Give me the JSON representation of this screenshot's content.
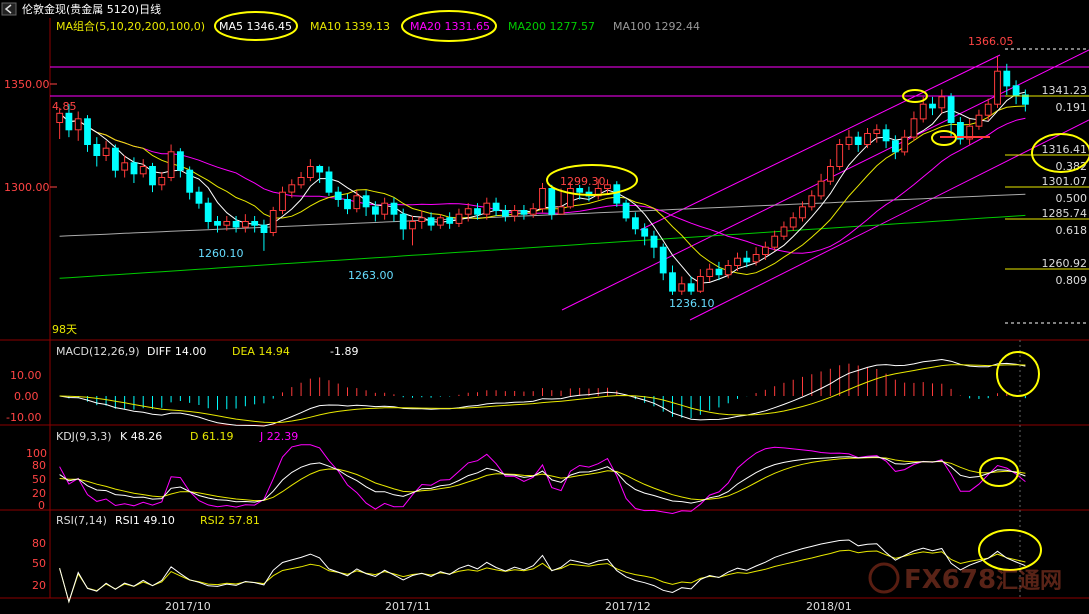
{
  "window": {
    "title": "伦敦金现(贵金属 5120)日线"
  },
  "colors": {
    "bg": "#000000",
    "up": "#ff3b3b",
    "down": "#00ffff",
    "ma5": "#ffffff",
    "ma10": "#e8e800",
    "ma20": "#ff00ff",
    "ma100": "#aaaaaa",
    "ma200": "#00cc00",
    "fib": "#e8e800",
    "grid": "#8b0000",
    "circle": "#ffff00",
    "channel": "#ff00ff"
  },
  "main": {
    "ma_header": {
      "label": "MA组合(5,10,20,200,100,0)",
      "ma5": "MA5 1346.45",
      "ma10": "MA10 1339.13",
      "ma20": "MA20 1331.65",
      "ma200": "MA200 1277.57",
      "ma100": "MA100 1292.44"
    },
    "yticks": [
      "1350.00",
      "1300.00"
    ],
    "left_corner_label": "4.85",
    "days_label": "98天",
    "annotations": {
      "high": "1366.05",
      "peak_mid": "1299.30",
      "low_a": "1260.10",
      "low_b": "1263.00",
      "low_c": "1236.10"
    },
    "fib_levels": [
      {
        "price": "1341.23",
        "ratio": "0.191"
      },
      {
        "price": "1316.41",
        "ratio": "0.382"
      },
      {
        "price": "1301.07",
        "ratio": "0.500"
      },
      {
        "price": "1285.74",
        "ratio": "0.618"
      },
      {
        "price": "1260.92",
        "ratio": "0.809"
      }
    ]
  },
  "macd": {
    "label": "MACD(12,26,9)",
    "diff": "DIFF  14.00",
    "dea": "DEA  14.94",
    "macd": "-1.89",
    "yticks": [
      "10.00",
      "0.00",
      "-10.00"
    ]
  },
  "kdj": {
    "label": "KDJ(9,3,3)",
    "k": "K  48.26",
    "d": "D  61.19",
    "j": "J  22.39",
    "yticks": [
      "100",
      "80",
      "50",
      "20",
      "0"
    ]
  },
  "rsi": {
    "label": "RSI(7,14)",
    "rsi1": "RSI1  49.10",
    "rsi2": "RSI2  57.81",
    "yticks": [
      "80",
      "50",
      "20"
    ]
  },
  "xaxis": {
    "labels": [
      "2017/10",
      "2017/11",
      "2017/12",
      "2018/01"
    ]
  },
  "watermark": {
    "text": "FX678",
    "sub": "汇通网"
  },
  "chart_data": {
    "type": "candlestick",
    "title": "伦敦金现(贵金属 5120)日线",
    "candles": [
      [
        1330,
        1335,
        1338,
        1321
      ],
      [
        1335,
        1326,
        1340,
        1322
      ],
      [
        1326,
        1332,
        1336,
        1320
      ],
      [
        1332,
        1318,
        1334,
        1314
      ],
      [
        1318,
        1312,
        1322,
        1306
      ],
      [
        1312,
        1316,
        1320,
        1309
      ],
      [
        1316,
        1304,
        1318,
        1300
      ],
      [
        1304,
        1308,
        1312,
        1300
      ],
      [
        1308,
        1302,
        1311,
        1297
      ],
      [
        1302,
        1306,
        1310,
        1300
      ],
      [
        1306,
        1296,
        1308,
        1292
      ],
      [
        1296,
        1300,
        1303,
        1293
      ],
      [
        1300,
        1314,
        1318,
        1298
      ],
      [
        1314,
        1304,
        1316,
        1300
      ],
      [
        1304,
        1292,
        1306,
        1288
      ],
      [
        1292,
        1286,
        1295,
        1283
      ],
      [
        1286,
        1276,
        1289,
        1272
      ],
      [
        1276,
        1274,
        1279,
        1270
      ],
      [
        1274,
        1276,
        1279,
        1271
      ],
      [
        1276,
        1273,
        1279,
        1270
      ],
      [
        1273,
        1276,
        1280,
        1270
      ],
      [
        1276,
        1274,
        1279,
        1270
      ],
      [
        1274,
        1270,
        1277,
        1260
      ],
      [
        1270,
        1282,
        1284,
        1268
      ],
      [
        1282,
        1292,
        1295,
        1280
      ],
      [
        1292,
        1296,
        1299,
        1289
      ],
      [
        1296,
        1300,
        1303,
        1294
      ],
      [
        1300,
        1306,
        1310,
        1298
      ],
      [
        1306,
        1303,
        1307,
        1297
      ],
      [
        1303,
        1292,
        1306,
        1290
      ],
      [
        1292,
        1288,
        1295,
        1284
      ],
      [
        1288,
        1283,
        1291,
        1280
      ],
      [
        1283,
        1290,
        1293,
        1281
      ],
      [
        1290,
        1284,
        1293,
        1279
      ],
      [
        1284,
        1280,
        1287,
        1276
      ],
      [
        1280,
        1286,
        1289,
        1277
      ],
      [
        1286,
        1280,
        1289,
        1276
      ],
      [
        1280,
        1272,
        1283,
        1266
      ],
      [
        1272,
        1276,
        1279,
        1263
      ],
      [
        1276,
        1278,
        1282,
        1272
      ],
      [
        1278,
        1274,
        1281,
        1271
      ],
      [
        1274,
        1278,
        1280,
        1272
      ],
      [
        1278,
        1275,
        1281,
        1272
      ],
      [
        1275,
        1280,
        1283,
        1273
      ],
      [
        1280,
        1283,
        1286,
        1276
      ],
      [
        1283,
        1280,
        1286,
        1277
      ],
      [
        1280,
        1286,
        1289,
        1277
      ],
      [
        1286,
        1282,
        1289,
        1279
      ],
      [
        1282,
        1279,
        1285,
        1276
      ],
      [
        1279,
        1282,
        1285,
        1276
      ],
      [
        1282,
        1280,
        1285,
        1277
      ],
      [
        1280,
        1283,
        1286,
        1278
      ],
      [
        1283,
        1294,
        1297,
        1281
      ],
      [
        1294,
        1280,
        1296,
        1277
      ],
      [
        1280,
        1284,
        1294,
        1280
      ],
      [
        1284,
        1294,
        1297,
        1283
      ],
      [
        1294,
        1292,
        1296,
        1288
      ],
      [
        1292,
        1290,
        1295,
        1287
      ],
      [
        1290,
        1294,
        1299,
        1288
      ],
      [
        1294,
        1296,
        1299,
        1291
      ],
      [
        1296,
        1286,
        1298,
        1284
      ],
      [
        1286,
        1278,
        1288,
        1276
      ],
      [
        1278,
        1272,
        1281,
        1269
      ],
      [
        1272,
        1268,
        1275,
        1263
      ],
      [
        1268,
        1262,
        1271,
        1256
      ],
      [
        1262,
        1248,
        1264,
        1244
      ],
      [
        1248,
        1238,
        1252,
        1236
      ],
      [
        1238,
        1242,
        1246,
        1236
      ],
      [
        1242,
        1238,
        1246,
        1236
      ],
      [
        1238,
        1246,
        1250,
        1237
      ],
      [
        1246,
        1250,
        1253,
        1243
      ],
      [
        1250,
        1247,
        1254,
        1244
      ],
      [
        1247,
        1252,
        1255,
        1245
      ],
      [
        1252,
        1256,
        1259,
        1249
      ],
      [
        1256,
        1254,
        1260,
        1251
      ],
      [
        1254,
        1258,
        1262,
        1252
      ],
      [
        1258,
        1262,
        1265,
        1255
      ],
      [
        1262,
        1268,
        1271,
        1260
      ],
      [
        1268,
        1273,
        1276,
        1266
      ],
      [
        1273,
        1278,
        1281,
        1271
      ],
      [
        1278,
        1284,
        1287,
        1276
      ],
      [
        1284,
        1290,
        1293,
        1282
      ],
      [
        1290,
        1298,
        1302,
        1288
      ],
      [
        1298,
        1306,
        1310,
        1296
      ],
      [
        1306,
        1318,
        1321,
        1304
      ],
      [
        1318,
        1322,
        1326,
        1315
      ],
      [
        1322,
        1318,
        1325,
        1314
      ],
      [
        1318,
        1324,
        1327,
        1316
      ],
      [
        1324,
        1326,
        1329,
        1319
      ],
      [
        1326,
        1320,
        1329,
        1316
      ],
      [
        1320,
        1314,
        1323,
        1310
      ],
      [
        1314,
        1322,
        1326,
        1312
      ],
      [
        1322,
        1332,
        1336,
        1320
      ],
      [
        1332,
        1340,
        1344,
        1330
      ],
      [
        1340,
        1338,
        1344,
        1334
      ],
      [
        1338,
        1344,
        1348,
        1335
      ],
      [
        1344,
        1330,
        1346,
        1322
      ],
      [
        1330,
        1321,
        1333,
        1318
      ],
      [
        1321,
        1328,
        1332,
        1318
      ],
      [
        1328,
        1334,
        1337,
        1326
      ],
      [
        1334,
        1340,
        1343,
        1331
      ],
      [
        1340,
        1358,
        1366,
        1338
      ],
      [
        1358,
        1350,
        1362,
        1345
      ],
      [
        1350,
        1345,
        1353,
        1340
      ],
      [
        1345,
        1340,
        1348,
        1336
      ]
    ],
    "ylim": [
      1225,
      1375
    ]
  }
}
